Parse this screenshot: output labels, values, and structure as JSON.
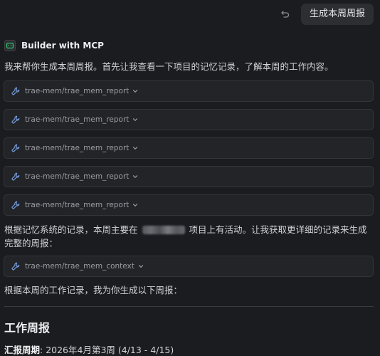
{
  "user_message": "生成本周周报",
  "agent": {
    "name": "Builder with MCP"
  },
  "messages": {
    "intro": "我来帮你生成本周周报。首先让我查看一下项目的记忆记录，了解本周的工作内容。",
    "activity_part1": "根据记忆系统的记录，本周主要在",
    "activity_part2": "项目上有活动。让我获取更详细的记录来生成完整的周报：",
    "summary_intro": "根据本周的工作记录，我为你生成以下周报："
  },
  "tool_calls": [
    {
      "label": "trae-mem/trae_mem_report"
    },
    {
      "label": "trae-mem/trae_mem_report"
    },
    {
      "label": "trae-mem/trae_mem_report"
    },
    {
      "label": "trae-mem/trae_mem_report"
    },
    {
      "label": "trae-mem/trae_mem_report"
    },
    {
      "label": "trae-mem/trae_mem_context"
    }
  ],
  "report": {
    "title": "工作周报",
    "period_label": "汇报周期",
    "period_value": ": 2026年4月第3周 (4/13 - 4/15)"
  },
  "colors": {
    "background": "#1b1c1f",
    "tool_icon": "#7aa2e8"
  }
}
